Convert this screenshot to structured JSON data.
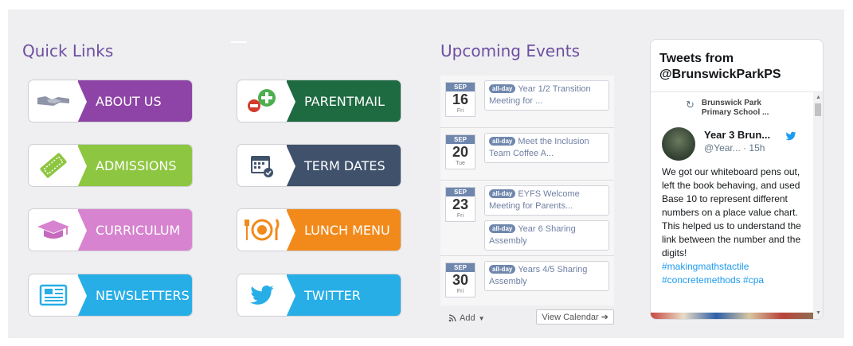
{
  "sections": {
    "quick_links_title": "Quick Links",
    "events_title": "Upcoming Events"
  },
  "quick_links": [
    {
      "label": "ABOUT US",
      "color": "#8e44a7",
      "icon": "handshake-icon"
    },
    {
      "label": "PARENTMAIL",
      "color": "#1e6b41",
      "icon": "add-mail-icon"
    },
    {
      "label": "ADMISSIONS",
      "color": "#8dc641",
      "icon": "ticket-icon"
    },
    {
      "label": "TERM DATES",
      "color": "#3f516b",
      "icon": "calendar-icon"
    },
    {
      "label": "CURRICULUM",
      "color": "#d783cf",
      "icon": "graduation-cap-icon"
    },
    {
      "label": "LUNCH MENU",
      "color": "#f28a1b",
      "icon": "cutlery-icon"
    },
    {
      "label": "NEWSLETTERS",
      "color": "#27aee6",
      "icon": "newspaper-icon"
    },
    {
      "label": "TWITTER",
      "color": "#27aee6",
      "icon": "twitter-bird-icon"
    }
  ],
  "events": {
    "badge": "all-day",
    "groups": [
      {
        "month": "SEP",
        "day": "16",
        "dow": "Fri",
        "items": [
          "Year 1/2 Transition Meeting for ..."
        ]
      },
      {
        "month": "SEP",
        "day": "20",
        "dow": "Tue",
        "items": [
          "Meet the Inclusion Team Coffee A..."
        ]
      },
      {
        "month": "SEP",
        "day": "23",
        "dow": "Fri",
        "items": [
          "EYFS Welcome Meeting for Parents...",
          "Year 6 Sharing Assembly"
        ]
      },
      {
        "month": "SEP",
        "day": "30",
        "dow": "Fri",
        "items": [
          "Years 4/5 Sharing Assembly"
        ]
      }
    ],
    "add_label": "Add",
    "view_calendar_label": "View Calendar ➔"
  },
  "twitter": {
    "title": "Tweets from @BrunswickParkPS",
    "retweeted_by": "Brunswick Park Primary School ...",
    "author": "Year 3 Brun...",
    "handle": "@Year... · 15h",
    "text": "We got our whiteboard pens out, left the book behaving, and used Base 10 to represent different numbers on a place value chart. This helped us to understand the link between the number and the digits!",
    "hashtags_1": "#makingmathstactile",
    "hashtags_2": "#concretemethods #cpa"
  }
}
